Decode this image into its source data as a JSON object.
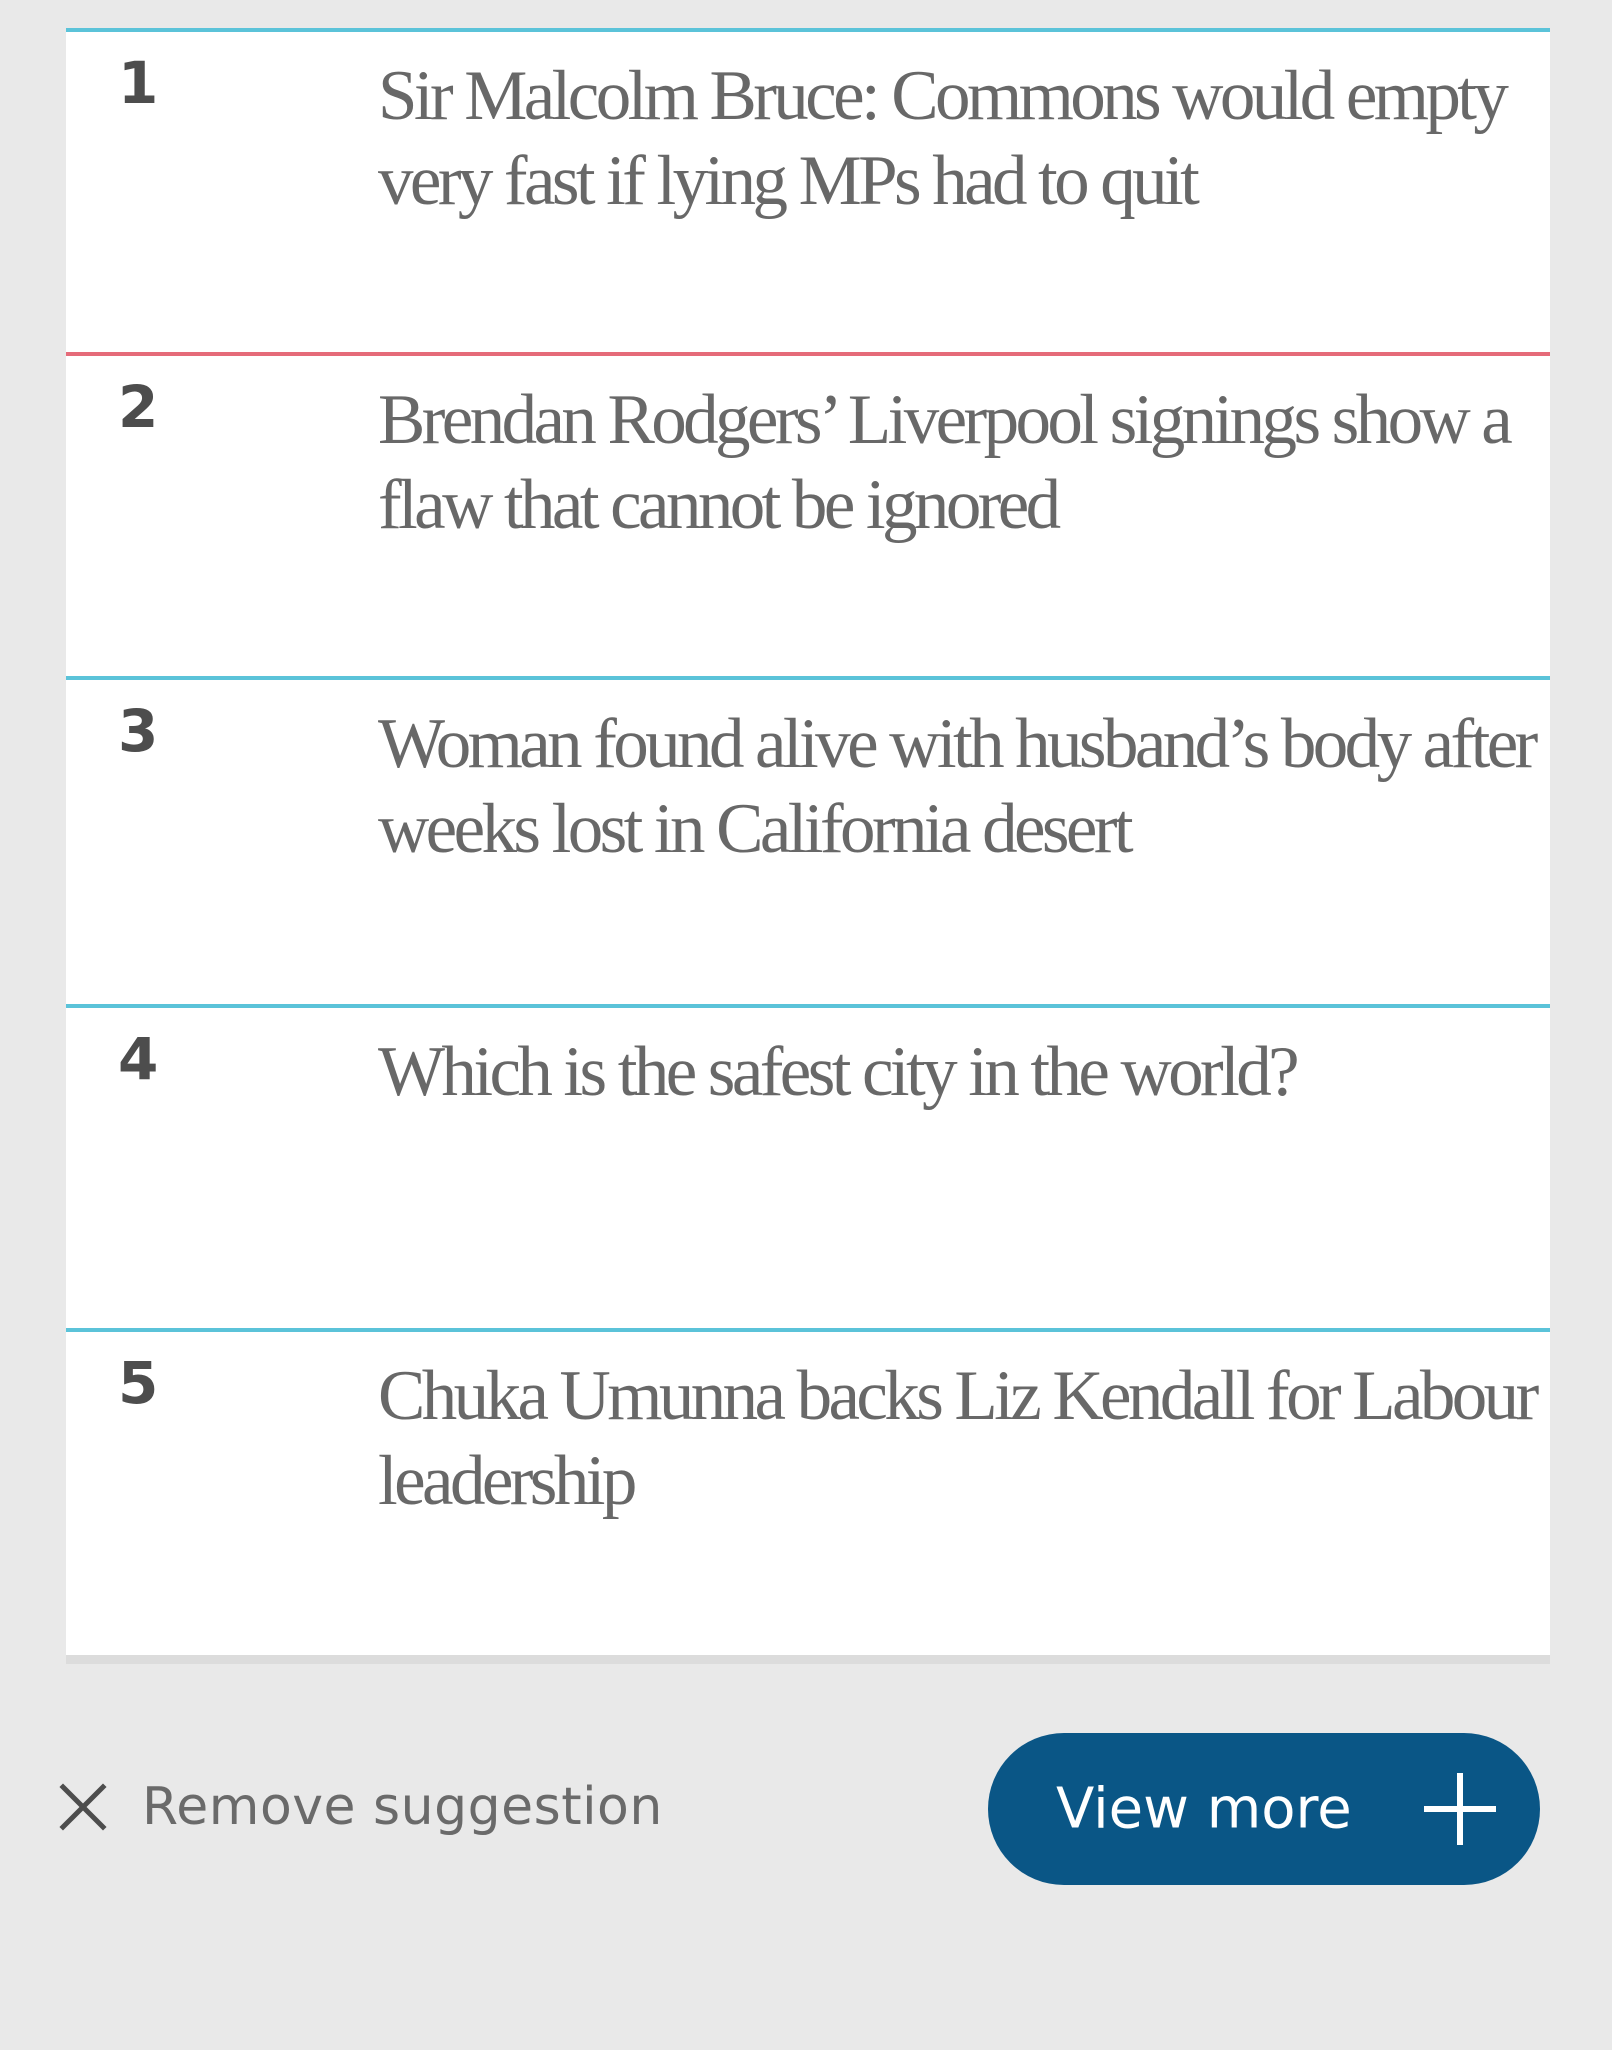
{
  "most_popular": {
    "items": [
      {
        "rank": "1",
        "headline": "Sir Malcolm Bruce: Commons would empty very fast if lying MPs had to quit"
      },
      {
        "rank": "2",
        "headline": "Brendan Rodgers’ Liverpool signings show a flaw that cannot be ignored"
      },
      {
        "rank": "3",
        "headline": "Woman found alive with husband’s body after weeks lost in California desert"
      },
      {
        "rank": "4",
        "headline": "Which is the safest city in the world?"
      },
      {
        "rank": "5",
        "headline": "Chuka Umunna backs Liz Kendall for Labour leadership"
      }
    ]
  },
  "footer": {
    "remove_label": "Remove suggestion",
    "remove_icon": "close-icon",
    "view_more_label": "View more",
    "view_more_icon": "plus-icon"
  },
  "colors": {
    "page_background": "#e9e9e9",
    "item_divider": "#5bc3d9",
    "item_divider_alt": "#e56b79",
    "button_background": "#0a5686",
    "headline_text": "#686868"
  }
}
